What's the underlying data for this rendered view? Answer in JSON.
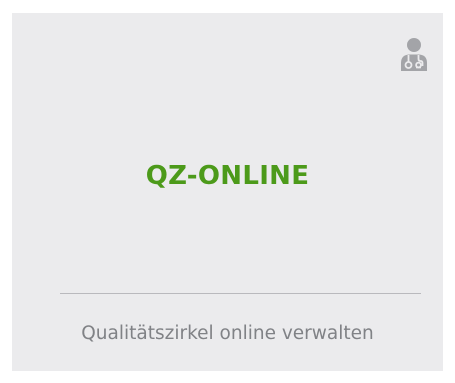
{
  "tile": {
    "title": "QZ-ONLINE",
    "subtitle": "Qualitätszirkel online verwalten",
    "icon": "doctor-stethoscope-icon",
    "colors": {
      "background": "#ebebed",
      "title": "#4c9a1a",
      "subtitle": "#808286",
      "icon": "#a3a4a8",
      "divider": "#b9b9bd"
    }
  }
}
